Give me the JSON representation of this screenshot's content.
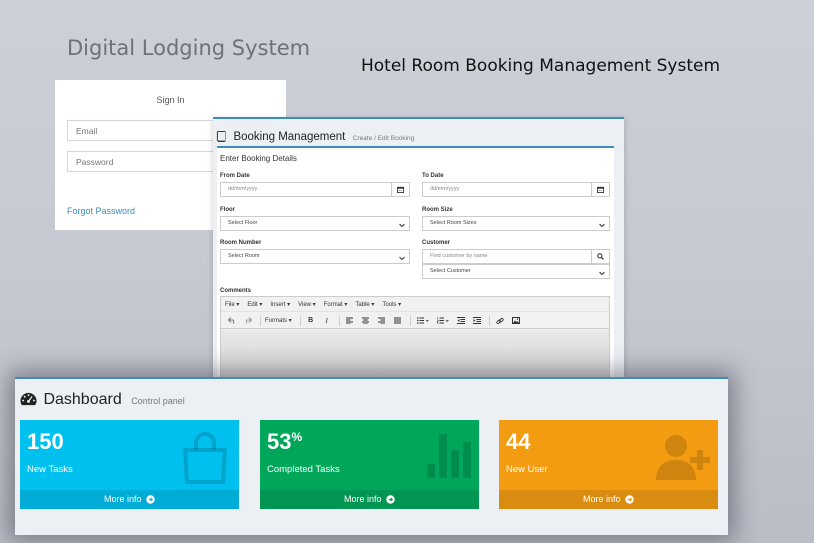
{
  "brand": {
    "title": "Digital Lodging System"
  },
  "hero": {
    "title": "Hotel Room Booking Management System"
  },
  "signin": {
    "heading": "Sign In",
    "email_placeholder": "Email",
    "password_placeholder": "Password",
    "forgot_label": "Forgot Password"
  },
  "booking": {
    "title": "Booking Management",
    "subtitle": "Create / Edit Booking",
    "box_title": "Enter Booking Details",
    "from_date": {
      "label": "From Date",
      "placeholder": "dd/mm/yyyy"
    },
    "to_date": {
      "label": "To Date",
      "placeholder": "dd/mm/yyyy"
    },
    "floor": {
      "label": "Floor",
      "value": "Select Floor"
    },
    "room_size": {
      "label": "Room Size",
      "value": "Select Room Sizes"
    },
    "room_number": {
      "label": "Room Number",
      "value": "Select Room"
    },
    "customer": {
      "label": "Customer",
      "search_placeholder": "Find customer by name",
      "select_value": "Select Customer"
    },
    "comments": {
      "label": "Comments"
    },
    "editor": {
      "menus": [
        "File",
        "Edit",
        "Insert",
        "View",
        "Format",
        "Table",
        "Tools"
      ],
      "formats_label": "Formats"
    }
  },
  "dashboard": {
    "title": "Dashboard",
    "subtitle": "Control panel",
    "tiles": [
      {
        "value": "150",
        "suffix": "",
        "label": "New Tasks",
        "footer": "More info",
        "color": "#00c0ef"
      },
      {
        "value": "53",
        "suffix": "%",
        "label": "Completed Tasks",
        "footer": "More info",
        "color": "#00a65a"
      },
      {
        "value": "44",
        "suffix": "",
        "label": "New User",
        "footer": "More info",
        "color": "#f39c12"
      }
    ]
  },
  "colors": {
    "primary": "#3c8dbc",
    "panel_bg": "#ecf0f5"
  },
  "icons": {
    "booking": "book-icon",
    "calendar": "calendar-icon",
    "search": "search-icon",
    "dashboard": "dashboard-icon",
    "tile_1": "shopping-bag-icon",
    "tile_2": "bar-chart-icon",
    "tile_3": "user-plus-icon",
    "more_info": "arrow-circle-right-icon"
  }
}
